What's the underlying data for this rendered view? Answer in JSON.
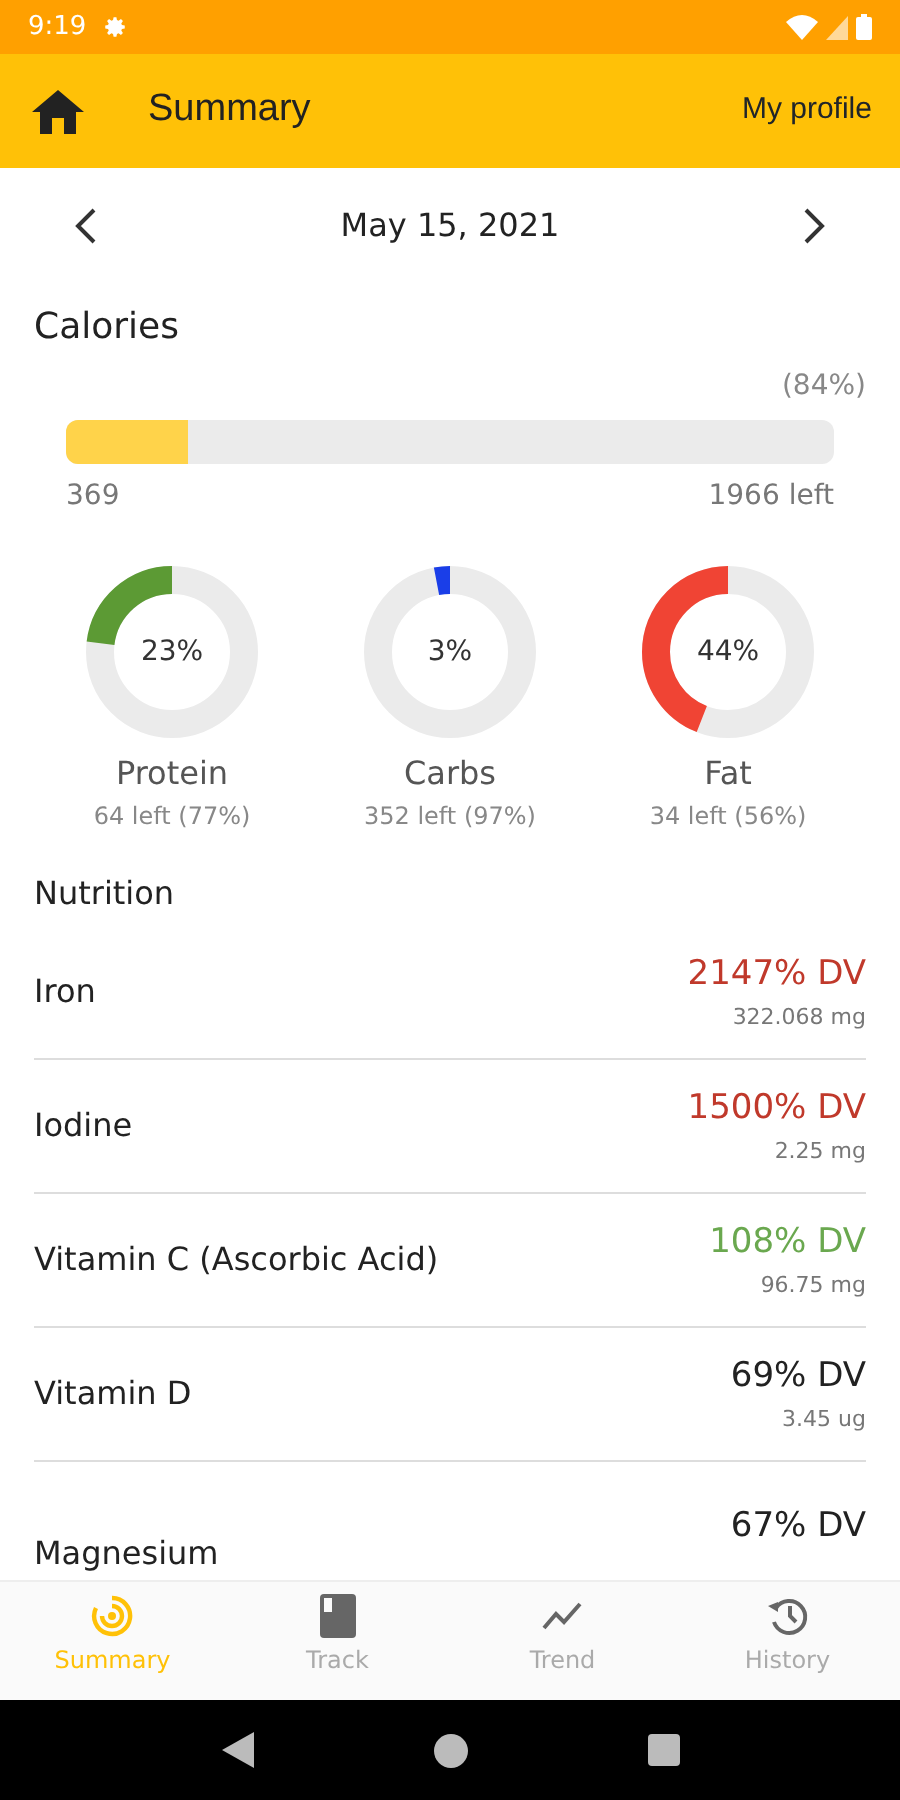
{
  "status_bar": {
    "time": "9:19"
  },
  "app_bar": {
    "title": "Summary",
    "action": "My profile"
  },
  "date_nav": {
    "date": "May 15, 2021"
  },
  "calories": {
    "title": "Calories",
    "percent": "(84%)",
    "level": 0.16,
    "consumed": "369",
    "left": "1966 left"
  },
  "macros": [
    {
      "name": "Protein",
      "percent": "23%",
      "color": "#5c9a34",
      "detail": "64 left (77%)"
    },
    {
      "name": "Carbs",
      "percent": "3%",
      "color": "#1a3ee8",
      "detail": "352 left (97%)"
    },
    {
      "name": "Fat",
      "percent": "44%",
      "color": "#f04434",
      "detail": "34 left (56%)"
    }
  ],
  "nutrition": {
    "title": "Nutrition",
    "rows": [
      {
        "name": "Iron",
        "dv": "2147% DV",
        "color": "#c0392b",
        "amount": "322.068 mg"
      },
      {
        "name": "Iodine",
        "dv": "1500% DV",
        "color": "#c0392b",
        "amount": "2.25 mg"
      },
      {
        "name": "Vitamin C (Ascorbic Acid)",
        "dv": "108% DV",
        "color": "#6aa84f",
        "amount": "96.75 mg"
      },
      {
        "name": "Vitamin D",
        "dv": "69% DV",
        "color": "#222222",
        "amount": "3.45 ug"
      },
      {
        "name": "Magnesium",
        "dv": "67% DV",
        "color": "#222222"
      }
    ]
  },
  "bottom_nav": [
    {
      "label": "Summary",
      "kind": "summary",
      "selected": true
    },
    {
      "label": "Track",
      "kind": "track",
      "selected": false
    },
    {
      "label": "Trend",
      "kind": "trend",
      "selected": false
    },
    {
      "label": "History",
      "kind": "history",
      "selected": false
    }
  ]
}
